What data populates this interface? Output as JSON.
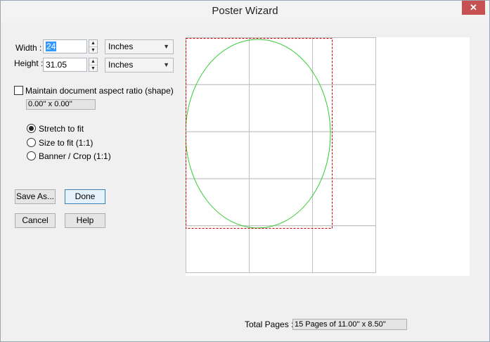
{
  "window": {
    "title": "Poster Wizard",
    "close_glyph": "✕"
  },
  "size": {
    "width_label": "Width :",
    "width_value": "24",
    "height_label": "Height :",
    "height_value": "31.05",
    "width_unit": "Inches",
    "height_unit": "Inches"
  },
  "aspect": {
    "checkbox_label": "Maintain document aspect ratio (shape)",
    "checked": false,
    "ratio_readout": "0.00'' x 0.00''"
  },
  "fit_options": [
    {
      "label": "Stretch to fit",
      "selected": true
    },
    {
      "label": "Size to fit  (1:1)",
      "selected": false
    },
    {
      "label": "Banner / Crop (1:1)",
      "selected": false
    }
  ],
  "buttons": {
    "save_as": "Save As...",
    "done": "Done",
    "cancel": "Cancel",
    "help": "Help"
  },
  "preview": {
    "page_columns": 3,
    "page_rows": 5,
    "grid_color": "#c0c0c0",
    "crop_color": "#cc0000",
    "ellipse_color": "#33cc33"
  },
  "totals": {
    "label": "Total Pages :",
    "value": "15 Pages of 11.00'' x 8.50''"
  }
}
